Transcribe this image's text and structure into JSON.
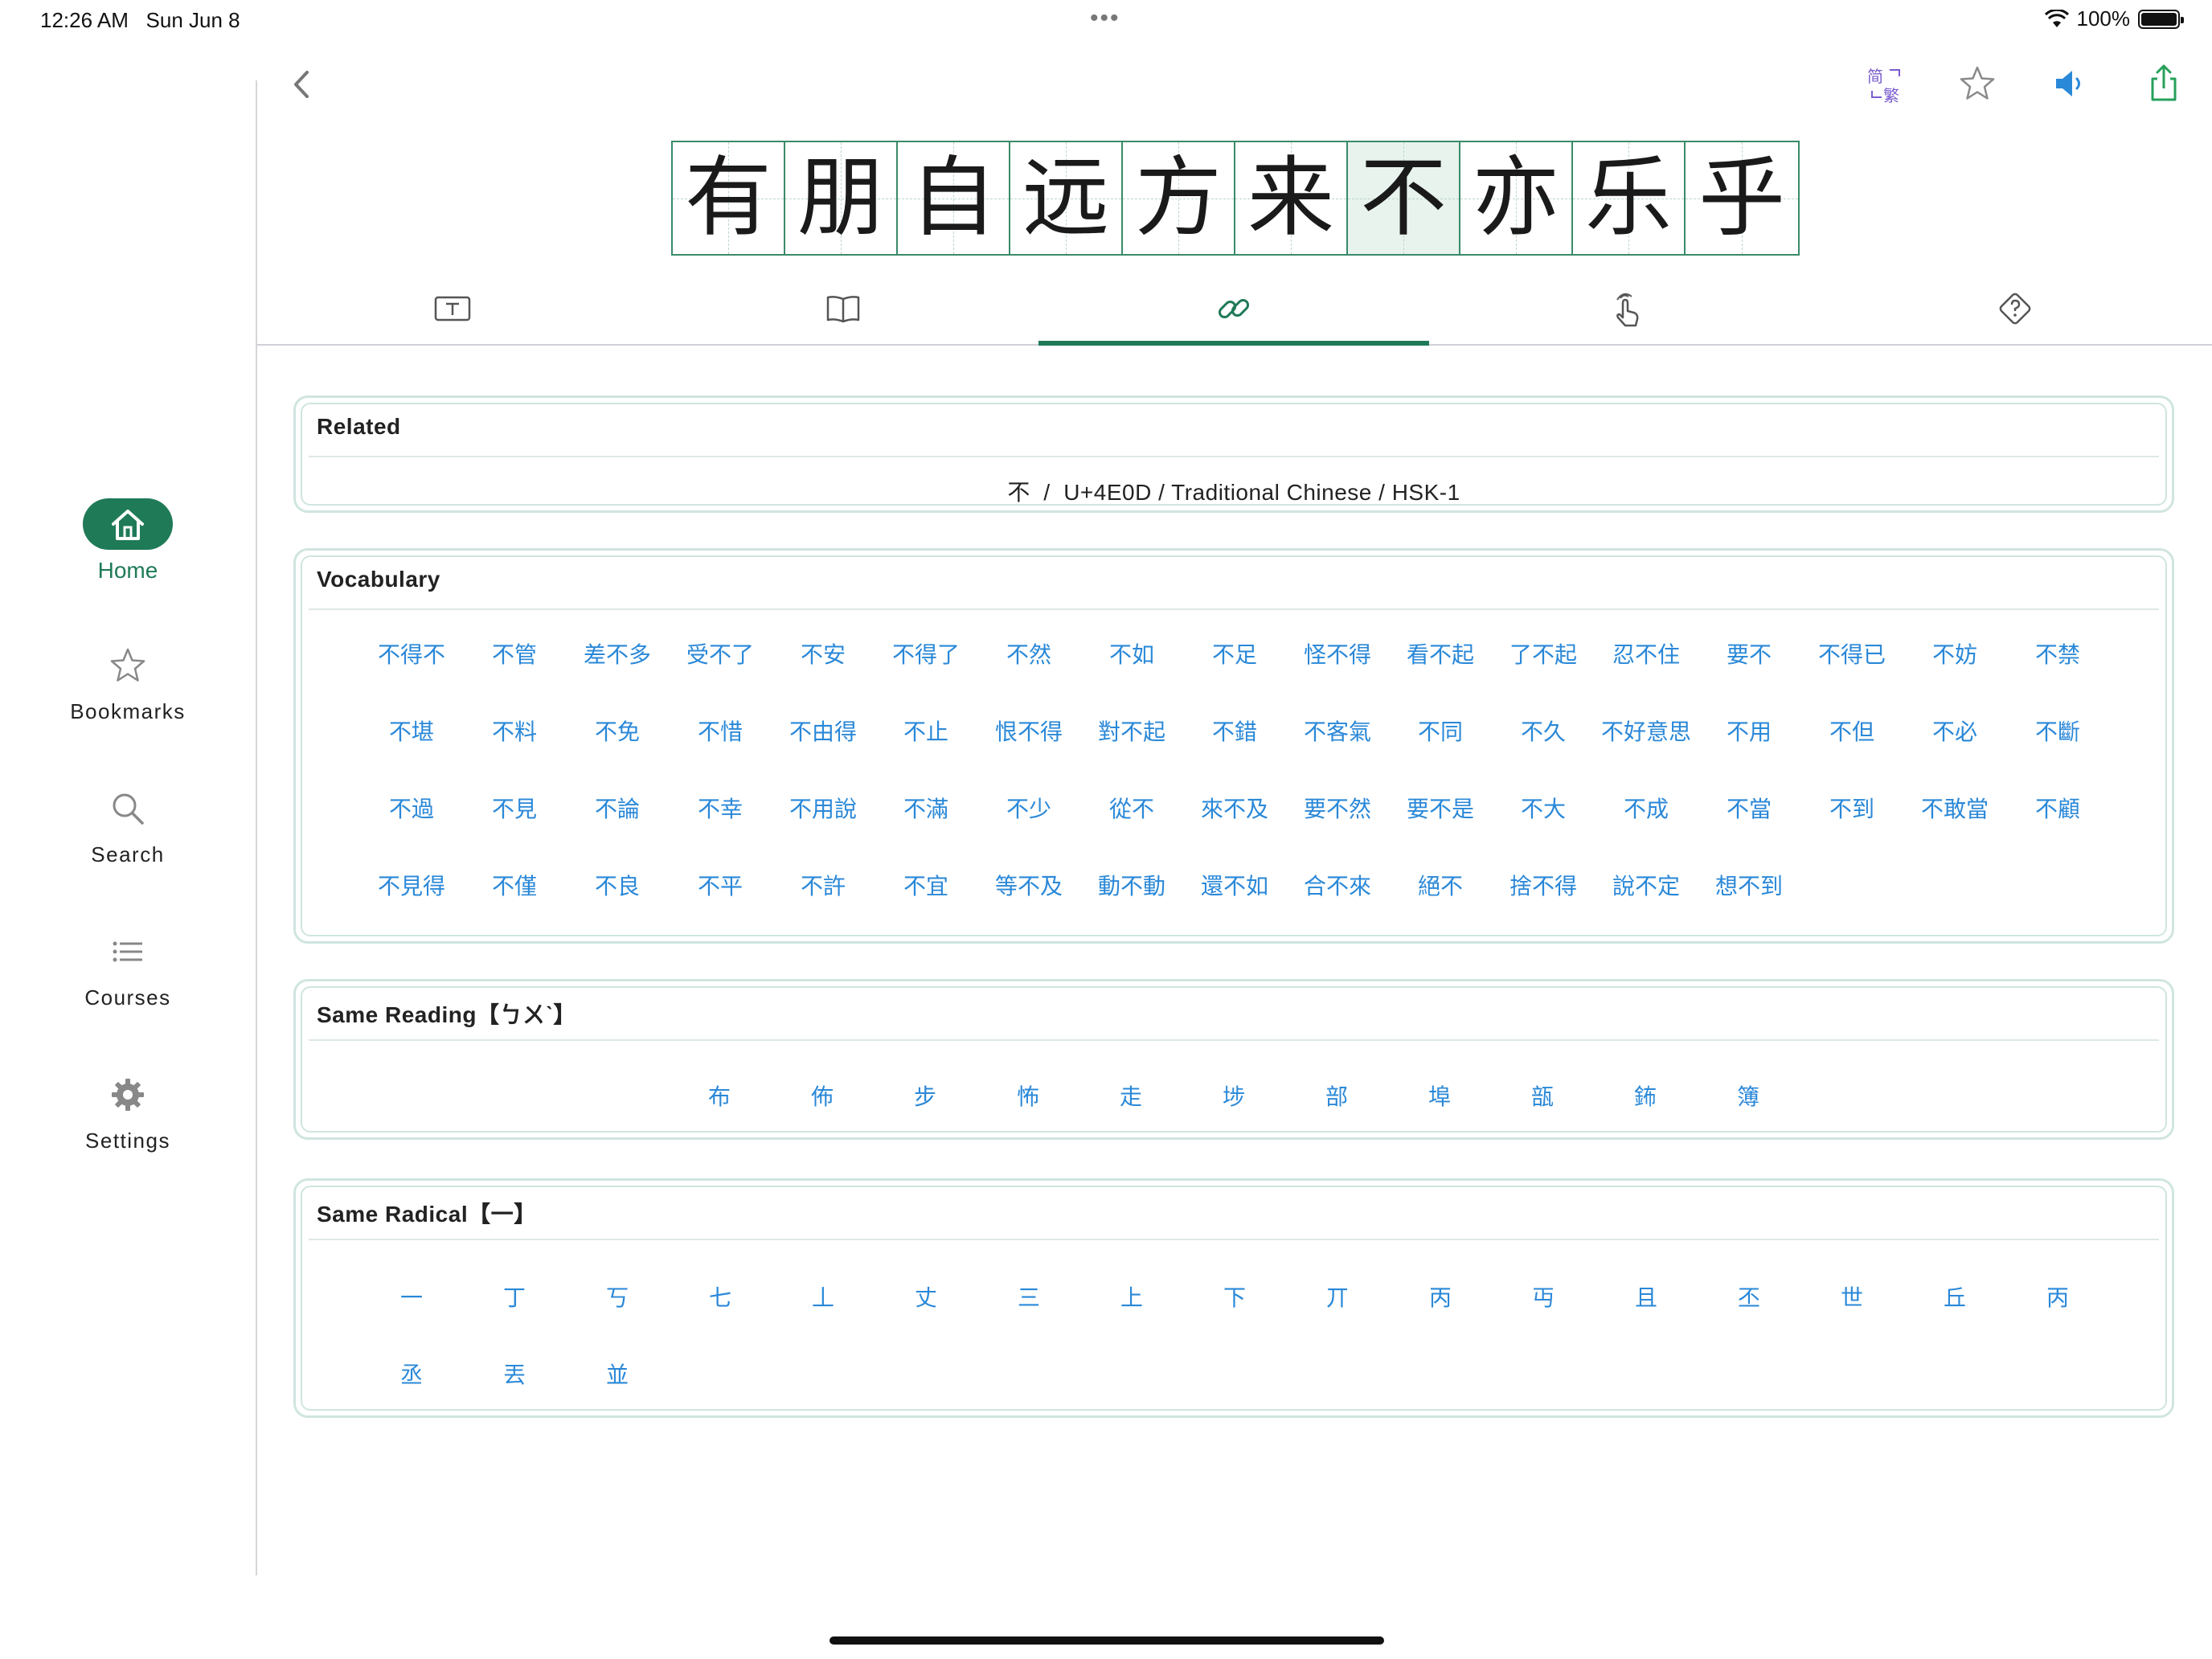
{
  "status_bar": {
    "time": "12:26 AM",
    "date": "Sun Jun 8",
    "battery": "100%",
    "dots": "•••"
  },
  "sidebar": {
    "items": [
      {
        "label": "Home",
        "icon": "home-icon",
        "active": true
      },
      {
        "label": "Bookmarks",
        "icon": "star-icon",
        "active": false
      },
      {
        "label": "Search",
        "icon": "search-icon",
        "active": false
      },
      {
        "label": "Courses",
        "icon": "list-icon",
        "active": false
      },
      {
        "label": "Settings",
        "icon": "gear-icon",
        "active": false
      }
    ]
  },
  "toolbar": {
    "back_icon": "chevron-left-icon",
    "script_toggle": {
      "simplified": "简",
      "traditional": "繁"
    },
    "icons": [
      "simplified-traditional-toggle-icon",
      "star-icon",
      "speaker-icon",
      "share-icon"
    ]
  },
  "sentence": {
    "chars": [
      "有",
      "朋",
      "自",
      "远",
      "方",
      "来",
      "不",
      "亦",
      "乐",
      "乎"
    ],
    "selected_index": 6
  },
  "tabs": {
    "icons": [
      "text-box-icon",
      "book-icon",
      "link-icon",
      "hand-tap-icon",
      "help-diamond-icon"
    ],
    "active_index": 2
  },
  "related": {
    "title": "Related",
    "info": "不  /  U+4E0D / Traditional Chinese / HSK-1"
  },
  "vocabulary": {
    "title": "Vocabulary",
    "words": [
      "不得不",
      "不管",
      "差不多",
      "受不了",
      "不安",
      "不得了",
      "不然",
      "不如",
      "不足",
      "怪不得",
      "看不起",
      "了不起",
      "忍不住",
      "要不",
      "不得已",
      "不妨",
      "不禁",
      "不堪",
      "不料",
      "不免",
      "不惜",
      "不由得",
      "不止",
      "恨不得",
      "對不起",
      "不錯",
      "不客氣",
      "不同",
      "不久",
      "不好意思",
      "不用",
      "不但",
      "不必",
      "不斷",
      "不過",
      "不見",
      "不論",
      "不幸",
      "不用說",
      "不滿",
      "不少",
      "從不",
      "來不及",
      "要不然",
      "要不是",
      "不大",
      "不成",
      "不當",
      "不到",
      "不敢當",
      "不顧",
      "不見得",
      "不僅",
      "不良",
      "不平",
      "不許",
      "不宜",
      "等不及",
      "動不動",
      "還不如",
      "合不來",
      "絕不",
      "捨不得",
      "說不定",
      "想不到"
    ]
  },
  "same_reading": {
    "title": "Same Reading【ㄅㄨˋ】",
    "chars": [
      "布",
      "佈",
      "步",
      "怖",
      "走",
      "埗",
      "部",
      "埠",
      "瓿",
      "鈽",
      "簿"
    ]
  },
  "same_radical": {
    "title": "Same Radical【一】",
    "chars": [
      "一",
      "丁",
      "丂",
      "七",
      "丄",
      "丈",
      "三",
      "上",
      "下",
      "丌",
      "丙",
      "丏",
      "且",
      "丕",
      "世",
      "丘",
      "丙",
      "丞",
      "丟",
      "並"
    ]
  }
}
